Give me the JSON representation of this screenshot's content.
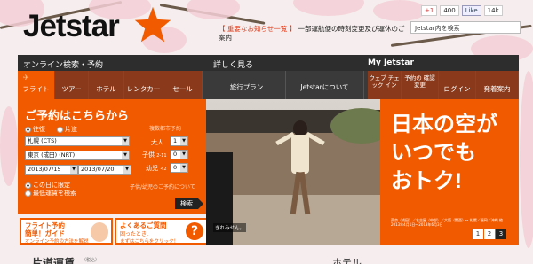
{
  "header": {
    "logo": "Jetstar",
    "notice_label": "【 重要なお知らせ一覧 】",
    "notice_text": "一部運航便の時刻変更及び運休のご案内",
    "social": {
      "gplus": "+1",
      "gplus_count": "400",
      "fb_like": "Like",
      "fb_count": "14k"
    },
    "search_placeholder": "Jetstar内を検索"
  },
  "nav": {
    "online_booking": "オンライン検索・予約",
    "explore": "詳しく見る",
    "my_jetstar": "My Jetstar"
  },
  "tabs": {
    "flight": "フライト",
    "tour": "ツアー",
    "hotel": "ホテル",
    "rental": "レンタカー",
    "sale": "セール",
    "travel_plan": "旅行プラン",
    "about": "Jetstarについて",
    "web_checkin": "ウェブ チェック イン",
    "confirm_change": "予約の 確認変更",
    "login": "ログイン",
    "ticket_issue": "発着案内"
  },
  "booking": {
    "title": "ご予約はこちらから",
    "multi_city_link": "複数都市予約",
    "roundtrip": "往復",
    "oneway": "片道",
    "origin": "札幌 (CTS)",
    "destination": "東京 (成田) (NRT)",
    "adult_label": "大人",
    "adult_value": "1",
    "child_label": "子供",
    "child_age": "2-11",
    "child_value": "0",
    "infant_label": "幼児",
    "infant_age": "<2",
    "infant_value": "0",
    "depart_date": "2013/07/15",
    "return_date": "2013/07/20",
    "date_exact": "この日に限定",
    "date_lowest": "最低運賃を検索",
    "child_help": "子供/幼児のご予約について",
    "search_button": "検索"
  },
  "guides": {
    "flight_guide_title_1": "フライト予約",
    "flight_guide_title_2": "簡単！ガイド",
    "flight_guide_sub": "オンライン予約の方法を解説",
    "faq_title": "よくあるご質問",
    "faq_title_2": "困ったとき、",
    "faq_sub": "まずはこちらをクリック！"
  },
  "hero": {
    "headline_1": "日本の空が",
    "headline_2": "いつでも",
    "headline_3": "おトク!",
    "photo_caption": "ぎれみせん。",
    "fine_print": "東京（成田）／名古屋（中部）／大阪（関西）⇔ 札幌／福岡／沖縄 他 2013年4月1日〜2013年6月3日",
    "pager": [
      "1",
      "2",
      "3"
    ]
  },
  "bottom": {
    "fare_heading": "片道運賃",
    "hotel_heading": "ホテル",
    "fare_note": "（税込）"
  },
  "colors": {
    "accent": "#f25a00",
    "nav_bg": "#2d2d2d"
  }
}
